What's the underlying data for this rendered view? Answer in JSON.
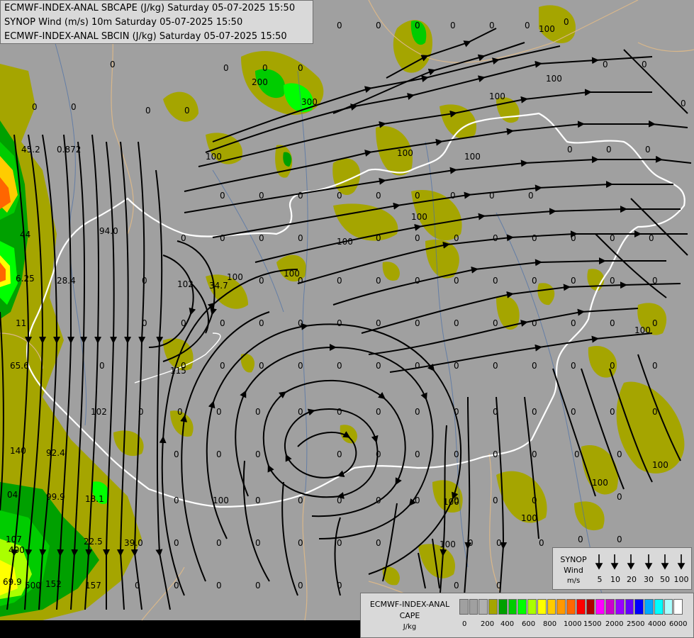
{
  "titles": {
    "line1": "ECMWF-INDEX-ANAL SBCAPE (J/kg) Saturday 05-07-2025 15:50",
    "line2": "SYNOP Wind (m/s) 10m Saturday 05-07-2025 15:50",
    "line3": "ECMWF-INDEX-ANAL SBCIN (J/kg) Saturday 05-07-2025 15:50"
  },
  "wind_legend": {
    "title_line1": "SYNOP",
    "title_line2": "Wind",
    "unit": "m/s",
    "values": [
      "5",
      "10",
      "20",
      "30",
      "50",
      "100"
    ]
  },
  "cape_legend": {
    "title_line1": "ECMWF-INDEX-ANAL",
    "title_line2": "CAPE",
    "unit": "J/kg",
    "colors": [
      "#a0a0a0",
      "#a0a0a0",
      "#b0b0b0",
      "#a5a500",
      "#00a000",
      "#00cc00",
      "#00ff00",
      "#aaff00",
      "#ffff00",
      "#ffcc00",
      "#ff9900",
      "#ff6600",
      "#ff0000",
      "#b00000",
      "#ff00ff",
      "#cc00cc",
      "#9900ff",
      "#6600ff",
      "#0000ff",
      "#00aaff",
      "#00ffff",
      "#aaffff",
      "#ffffff"
    ],
    "labels": [
      "0",
      "200",
      "400",
      "600",
      "800",
      "1000",
      "1500",
      "2000",
      "2500",
      "4000",
      "6000"
    ]
  },
  "map_labels": [
    "0",
    "100",
    "200",
    "300",
    "400",
    "500",
    "45.2",
    "0.872",
    "44",
    "6.25",
    "11",
    "65.6",
    "140",
    "92.4",
    "04",
    "99.9",
    "107",
    "69.9",
    "152",
    "157",
    "102",
    "94.0",
    "28.4",
    "18.1",
    "22.5",
    "39.0",
    "115",
    "34.7",
    "102"
  ],
  "colors": {
    "background": "#a0a0a0",
    "cape_low": "#a5a500",
    "border": "#ffffff",
    "streamline": "#000000"
  }
}
